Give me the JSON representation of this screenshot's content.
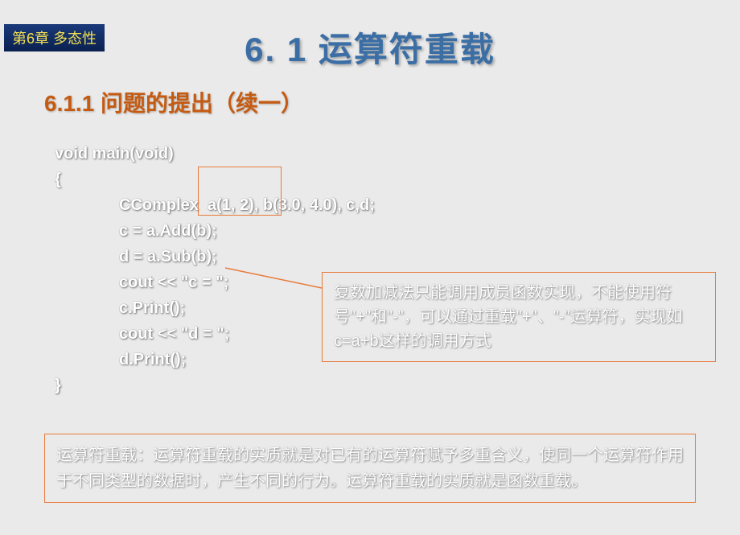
{
  "chapter_badge": "第6章  多态性",
  "main_title": "6. 1    运算符重载",
  "sub_title": "6.1.1   问题的提出（续一）",
  "code": {
    "line1": "void main(void)",
    "line2": "{",
    "line3": "CComplex  a(1, 2), b(3.0, 4.0), c,d;",
    "line4_pre": "c = ",
    "line4_hl": "a.Add(b);",
    "line5_pre": "d = ",
    "line5_hl": "a.Sub(b);",
    "line6": "cout << \"c = \";",
    "line7": "c.Print();",
    "line8": "cout << \"d = \";",
    "line9": "d.Print();",
    "line10": "}"
  },
  "callout": "复数加减法只能调用成员函数实现，不能使用符号\"+\"和\"-\"，可以通过重载\"+\"、\"-\"运算符，实现如c=a+b这样的调用方式",
  "bottom_note": "运算符重载：运算符重载的实质就是对已有的运算符赋予多重含义，使同一个运算符作用于不同类型的数据时，产生不同的行为。运算符重载的实质就是函数重载。"
}
